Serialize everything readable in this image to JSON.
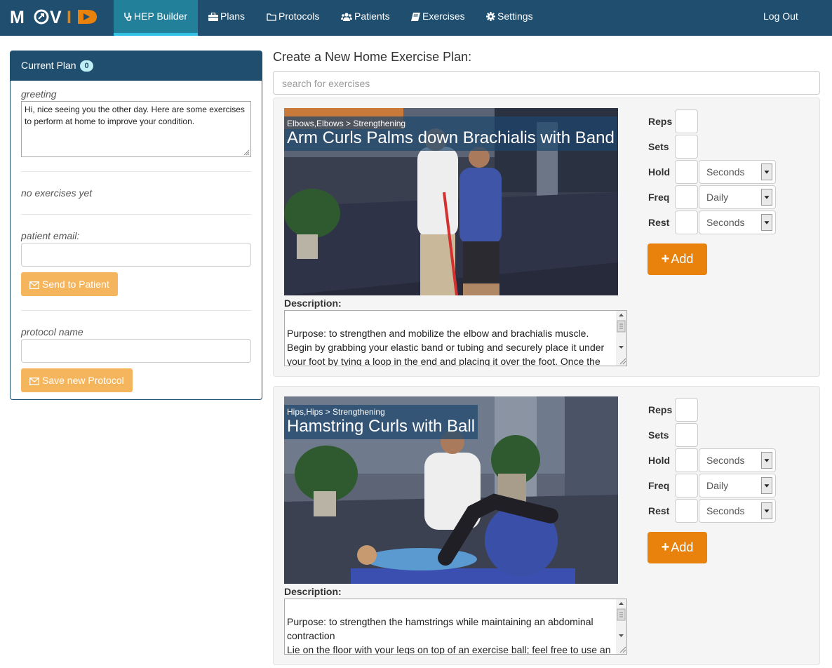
{
  "brand": {
    "name": "MOVID",
    "accent": "#e8820c",
    "nav_bg": "#1f4e6f"
  },
  "nav": {
    "items": [
      {
        "label": "HEP Builder",
        "icon": "stethoscope-icon",
        "active": true
      },
      {
        "label": "Plans",
        "icon": "briefcase-icon"
      },
      {
        "label": "Protocols",
        "icon": "folder-icon"
      },
      {
        "label": "Patients",
        "icon": "users-icon"
      },
      {
        "label": "Exercises",
        "icon": "book-icon"
      },
      {
        "label": "Settings",
        "icon": "gear-icon"
      }
    ],
    "logout": "Log Out"
  },
  "current_plan": {
    "title": "Current Plan",
    "count": "0",
    "greeting_label": "greeting",
    "greeting_text": "Hi, nice seeing you the other day.  Here are some exercises to perform at home to improve your condition.",
    "empty_text": "no exercises yet",
    "email_label": "patient email:",
    "send_button": "Send to Patient",
    "protocol_label": "protocol name",
    "save_button": "Save new Protocol"
  },
  "main": {
    "title": "Create a New Home Exercise Plan:",
    "search_placeholder": "search for exercises",
    "description_label": "Description:",
    "param_labels": {
      "reps": "Reps",
      "sets": "Sets",
      "hold": "Hold",
      "freq": "Freq",
      "rest": "Rest"
    },
    "add_label": "Add",
    "exercises": [
      {
        "category": "Elbows,Elbows > Strengthening",
        "title": "Arm Curls Palms down Brachialis with Band",
        "description": "Purpose: to strengthen and mobilize the elbow and brachialis muscle. Begin by grabbing your elastic band or tubing and securely place it under your foot by tying a loop in the end and placing it over the foot. Once the elastic band or tubing is safely anchored underneath the foot place the",
        "hold_unit": "Seconds",
        "freq_value": "Daily",
        "rest_unit": "Seconds"
      },
      {
        "category": "Hips,Hips > Strengthening",
        "title": "Hamstring Curls with Ball",
        "description": "Purpose: to strengthen the hamstrings while maintaining an abdominal contraction\nLie on the floor with your legs on top of an exercise ball; feel free to use an exercise mat or a comforter to make the floor more comfortable. The",
        "hold_unit": "Seconds",
        "freq_value": "Daily",
        "rest_unit": "Seconds"
      }
    ]
  }
}
